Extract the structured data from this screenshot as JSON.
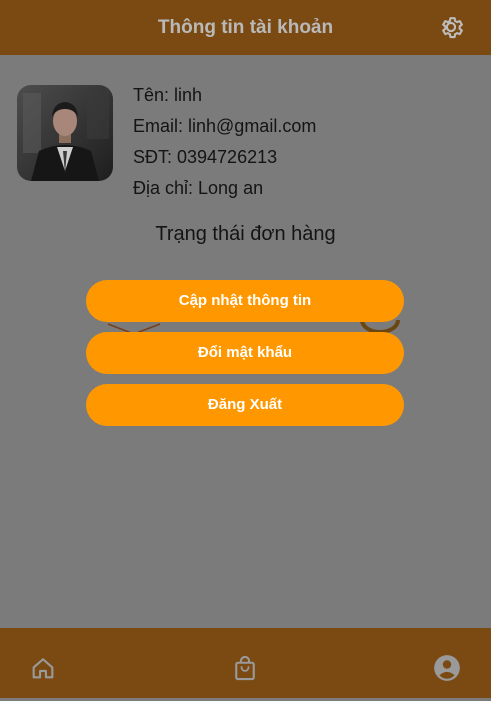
{
  "header": {
    "title": "Thông tin tài khoản",
    "settings_icon": "gear-icon"
  },
  "profile": {
    "name_line": "Tên: linh",
    "email_line": "Email: linh@gmail.com",
    "phone_line": "SĐT: 0394726213",
    "address_line": "Địa chỉ: Long an"
  },
  "orders": {
    "title": "Trạng thái đơn hàng"
  },
  "menu": {
    "update_label": "Cập nhật thông tin",
    "change_password_label": "Đổi mật khẩu",
    "logout_label": "Đăng Xuất"
  },
  "bottom_nav": {
    "items": [
      {
        "icon": "home-icon"
      },
      {
        "icon": "shopping-bag-icon"
      },
      {
        "icon": "account-circle-icon"
      }
    ]
  },
  "colors": {
    "header_bg": "#7a4a12",
    "overlay_bg": "#7b7b7b",
    "button_bg": "#ff9800",
    "button_text": "#ffffff",
    "icon_color": "#9a9a9a"
  }
}
